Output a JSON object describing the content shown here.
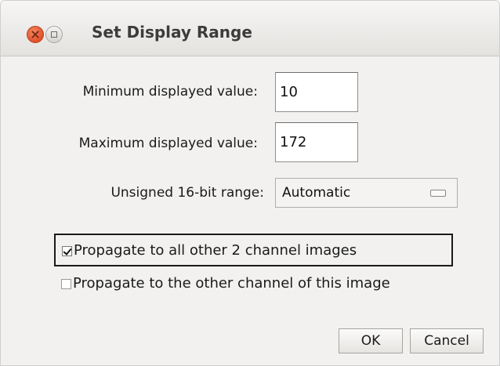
{
  "window": {
    "title": "Set Display Range"
  },
  "fields": {
    "min_label": "Minimum displayed value:",
    "min_value": "10",
    "max_label": "Maximum displayed value:",
    "max_value": "172",
    "range_label": "Unsigned 16-bit range:",
    "range_selected": "Automatic"
  },
  "options": {
    "propagate_all_label": "Propagate to all other 2 channel images",
    "propagate_all_checked": true,
    "propagate_other_label": "Propagate to the other channel of this image",
    "propagate_other_checked": false
  },
  "buttons": {
    "ok_label": "OK",
    "cancel_label": "Cancel"
  }
}
